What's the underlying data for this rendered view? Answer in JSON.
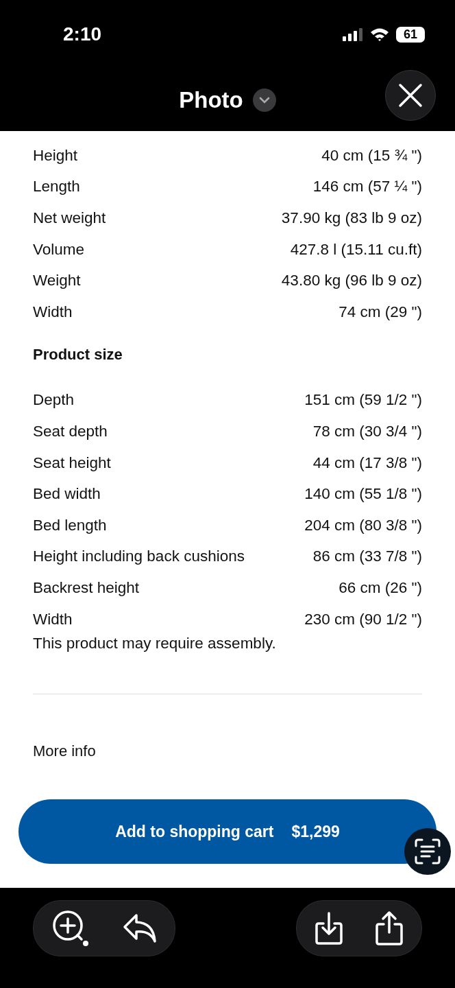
{
  "status_bar": {
    "time": "2:10",
    "battery": "61"
  },
  "header": {
    "title": "Photo"
  },
  "package_specs": [
    {
      "label": "Height",
      "value": "40 cm (15 ¾ \")"
    },
    {
      "label": "Length",
      "value": "146 cm (57 ¼ \")"
    },
    {
      "label": "Net weight",
      "value": "37.90 kg (83 lb 9 oz)"
    },
    {
      "label": "Volume",
      "value": "427.8 l (15.11 cu.ft)"
    },
    {
      "label": "Weight",
      "value": "43.80 kg (96 lb 9 oz)"
    },
    {
      "label": "Width",
      "value": "74 cm (29 \")"
    }
  ],
  "product_size": {
    "heading": "Product size",
    "specs": [
      {
        "label": "Depth",
        "value": "151 cm (59 1/2 \")"
      },
      {
        "label": "Seat depth",
        "value": "78 cm (30 3/4 \")"
      },
      {
        "label": "Seat height",
        "value": "44 cm (17 3/8 \")"
      },
      {
        "label": "Bed width",
        "value": "140 cm (55 1/8 \")"
      },
      {
        "label": "Bed length",
        "value": "204 cm (80 3/8 \")"
      },
      {
        "label": "Height including back cushions",
        "value": "86 cm (33 7/8 \")"
      },
      {
        "label": "Backrest height",
        "value": "66 cm (26 \")"
      },
      {
        "label": "Width",
        "value": "230 cm (90 1/2 \")"
      }
    ]
  },
  "assembly_note": "This product may require assembly.",
  "more_info": "More info",
  "cart_button": {
    "label": "Add to shopping cart",
    "price": "$1,299"
  }
}
